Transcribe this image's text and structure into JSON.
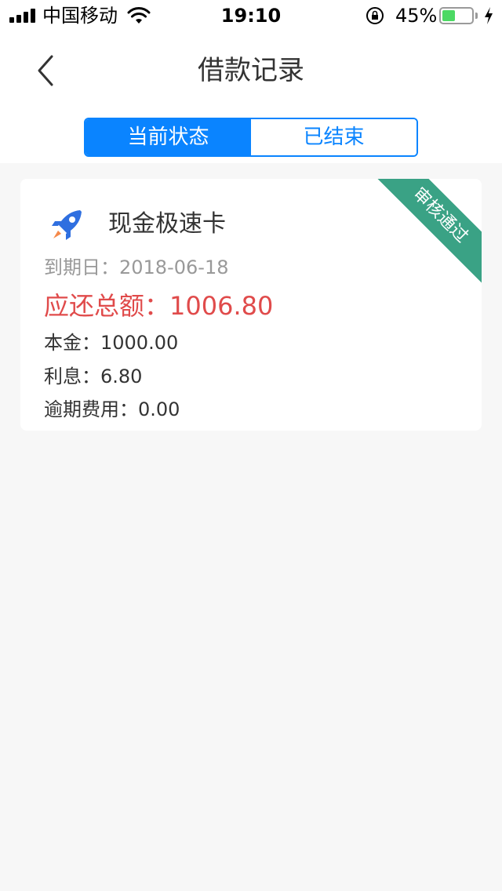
{
  "status_bar": {
    "carrier": "中国移动",
    "time": "19:10",
    "battery_percent": "45%",
    "battery_level": 0.45,
    "battery_color": "#4cd964",
    "icons": [
      "signal-icon",
      "wifi-icon",
      "rotation-lock-icon",
      "battery-icon",
      "charging-bolt-icon"
    ]
  },
  "nav": {
    "title": "借款记录",
    "back_icon": "chevron-left-icon"
  },
  "tabs": [
    {
      "label": "当前状态",
      "active": true
    },
    {
      "label": "已结束",
      "active": false
    }
  ],
  "colors": {
    "accent": "#0a84ff",
    "amount_red": "#e04b4b",
    "ribbon_green": "#3aa285",
    "background": "#f7f7f7"
  },
  "loan_card": {
    "icon": "rocket-icon",
    "product_name": "现金极速卡",
    "status_badge": "审核通过",
    "due_date_label": "到期日：",
    "due_date": "2018-06-18",
    "total_label": "应还总额：",
    "total_amount": "1006.80",
    "principal_label": "本金：",
    "principal": "1000.00",
    "interest_label": "利息：",
    "interest": "6.80",
    "overdue_fee_label": "逾期费用：",
    "overdue_fee": "0.00"
  }
}
